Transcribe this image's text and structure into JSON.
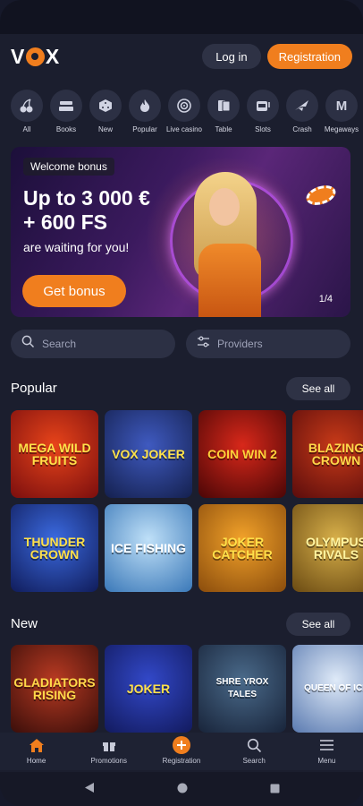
{
  "header": {
    "logo": "VOX",
    "login_label": "Log in",
    "registration_label": "Registration"
  },
  "categories": [
    {
      "label": "All",
      "icon": "cherries-icon"
    },
    {
      "label": "Books",
      "icon": "books-icon"
    },
    {
      "label": "New",
      "icon": "dice-icon"
    },
    {
      "label": "Popular",
      "icon": "flame-icon"
    },
    {
      "label": "Live casino",
      "icon": "roulette-icon"
    },
    {
      "label": "Table",
      "icon": "cards-icon"
    },
    {
      "label": "Slots",
      "icon": "slot-machine-icon"
    },
    {
      "label": "Crash",
      "icon": "plane-icon"
    },
    {
      "label": "Megaways",
      "icon": "m-icon"
    }
  ],
  "banner": {
    "tag": "Welcome bonus",
    "title_line1": "Up to 3 000 €",
    "title_line2": "+ 600 FS",
    "subtitle": "are waiting for you!",
    "cta": "Get bonus",
    "pager": "1/4"
  },
  "search": {
    "placeholder": "Search",
    "providers": "Providers"
  },
  "popular": {
    "title": "Popular",
    "see_all": "See all",
    "games": [
      {
        "name": "MEGA WILD FRUITS",
        "bg": "#8c1212"
      },
      {
        "name": "VOX JOKER",
        "bg": "#1f2d6a"
      },
      {
        "name": "COIN WIN 2",
        "bg": "#5a0a0a"
      },
      {
        "name": "BLAZING CROWN",
        "bg": "#6e1412"
      },
      {
        "name": "THUNDER CROWN",
        "bg": "#1a2d6e"
      },
      {
        "name": "ICE FISHING",
        "bg": "#4a8ec8"
      },
      {
        "name": "JOKER CATCHER",
        "bg": "#c07a18"
      },
      {
        "name": "OLYMPUS RIVALS",
        "bg": "#8a6a22"
      }
    ]
  },
  "new": {
    "title": "New",
    "see_all": "See all",
    "games": [
      {
        "name": "GLADIATORS RISING",
        "bg": "#5a1a12"
      },
      {
        "name": "JOKER",
        "bg": "#1d2c7a"
      },
      {
        "name": "SHRE YROX TALES",
        "bg": "#2a4060"
      },
      {
        "name": "QUEEN OF ICE",
        "bg": "#6a8ab8"
      }
    ]
  },
  "bottom_nav": [
    {
      "label": "Home",
      "icon": "home-icon"
    },
    {
      "label": "Promotions",
      "icon": "gift-icon"
    },
    {
      "label": "Registration",
      "icon": "plus-icon"
    },
    {
      "label": "Search",
      "icon": "search-icon"
    },
    {
      "label": "Menu",
      "icon": "menu-icon"
    }
  ],
  "colors": {
    "accent": "#f07e1e",
    "background": "#1b1e2e",
    "surface": "#2c3044"
  }
}
